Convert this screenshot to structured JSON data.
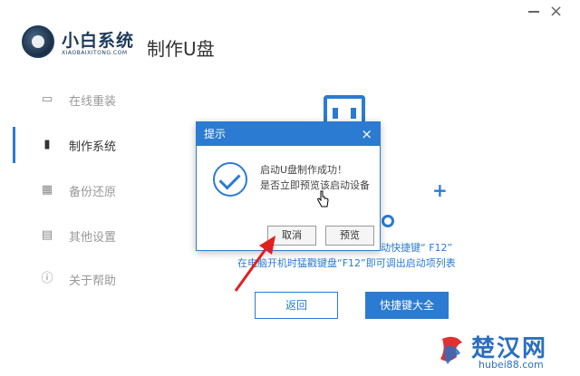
{
  "app": {
    "brand": "小白系统",
    "brand_sub": "XIAOBAIXITONG.COM",
    "page_title": "制作U盘"
  },
  "sidebar": {
    "items": [
      {
        "label": "在线重装",
        "icon": "monitor-icon"
      },
      {
        "label": "制作系统",
        "icon": "usb-icon"
      },
      {
        "label": "备份还原",
        "icon": "backup-icon"
      },
      {
        "label": "其他设置",
        "icon": "toolbox-icon"
      },
      {
        "label": "关于帮助",
        "icon": "info-icon"
      }
    ]
  },
  "main": {
    "tip1": "动快捷键“ F12”",
    "tip2": "在电脑开机时猛戳键盘“F12”即可调出启动项列表",
    "back_label": "返回",
    "shortcut_label": "快捷键大全"
  },
  "dialog": {
    "title": "提示",
    "close_glyph": "×",
    "line1": "启动U盘制作成功！",
    "line2": "是否立即预览该启动设备",
    "cancel_label": "取消",
    "preview_label": "预览"
  },
  "watermark": {
    "text": "楚汉网",
    "sub": "hubei88.com"
  },
  "colors": {
    "accent": "#2b7bd2",
    "arrow": "#e02020"
  }
}
